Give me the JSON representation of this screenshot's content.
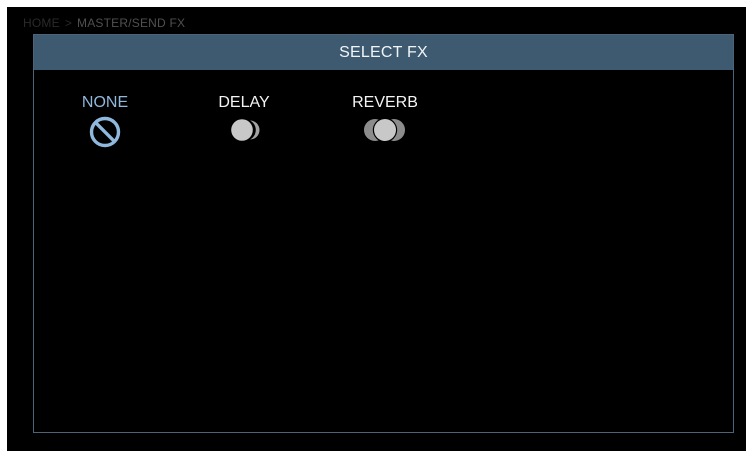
{
  "breadcrumb": {
    "home": "HOME",
    "separator": ">",
    "current": "MASTER/SEND FX"
  },
  "dialog": {
    "title": "SELECT FX"
  },
  "options": [
    {
      "label": "NONE",
      "icon": "prohibited-icon",
      "selected": true
    },
    {
      "label": "DELAY",
      "icon": "delay-icon",
      "selected": false
    },
    {
      "label": "REVERB",
      "icon": "reverb-icon",
      "selected": false
    }
  ],
  "colors": {
    "background": "#000000",
    "header": "#3e5a71",
    "border": "#4d6478",
    "selected": "#8fb8dc",
    "label": "#f4f4f4",
    "icon": "#c8c8c8"
  }
}
